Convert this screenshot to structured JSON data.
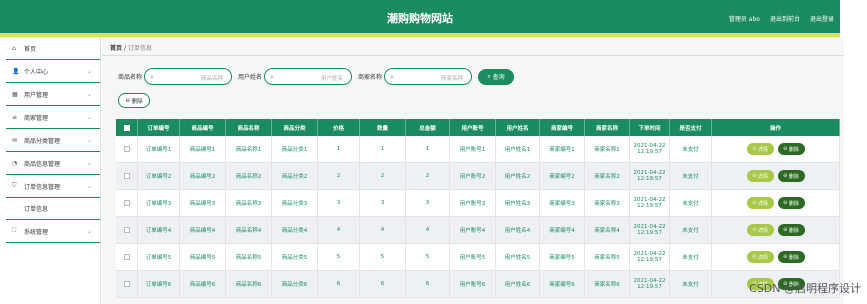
{
  "header": {
    "title": "潮购购物网站",
    "admin": "管理员 abo",
    "back": "退出到前台",
    "logout": "退出登录"
  },
  "sidebar": {
    "items": [
      {
        "icon": "home-icon",
        "glyph": "⌂",
        "label": "首页"
      },
      {
        "icon": "user-icon",
        "glyph": "👤",
        "label": "个人中心"
      },
      {
        "icon": "users-icon",
        "glyph": "▦",
        "label": "用户管理"
      },
      {
        "icon": "list-icon",
        "glyph": "≡",
        "label": "商家管理"
      },
      {
        "icon": "mail-icon",
        "glyph": "✉",
        "label": "商品分类管理"
      },
      {
        "icon": "clock-icon",
        "glyph": "◔",
        "label": "商品信息管理"
      },
      {
        "icon": "shield-icon",
        "glyph": "⛉",
        "label": "订单信息管理"
      }
    ],
    "sub": "订单信息",
    "last": {
      "icon": "expand-icon",
      "glyph": "⛶",
      "label": "系统管理"
    }
  },
  "crumb": {
    "home": "首页",
    "sep": "/",
    "current": "订单信息"
  },
  "search": {
    "f1_label": "商品名称",
    "f1_ph": "商品名称",
    "f2_label": "用户姓名",
    "f2_ph": "用户姓名",
    "f3_label": "商家名称",
    "f3_ph": "商家名称",
    "button": "查询"
  },
  "delete_top": "删除",
  "columns": [
    "",
    "订单编号",
    "商品编号",
    "商品名称",
    "商品分类",
    "价格",
    "数量",
    "总金额",
    "用户账号",
    "用户姓名",
    "商家编号",
    "商家名称",
    "下单时间",
    "是否支付",
    "操作"
  ],
  "rows": [
    [
      "订单编号1",
      "商品编号1",
      "商品名称1",
      "商品分类1",
      "1",
      "1",
      "1",
      "用户账号1",
      "用户姓名1",
      "商家编号1",
      "商家名称1",
      "2021-04-22 12:19:57",
      "未支付"
    ],
    [
      "订单编号2",
      "商品编号2",
      "商品名称2",
      "商品分类2",
      "2",
      "2",
      "2",
      "用户账号2",
      "用户姓名2",
      "商家编号2",
      "商家名称2",
      "2021-04-22 12:19:57",
      "未支付"
    ],
    [
      "订单编号3",
      "商品编号3",
      "商品名称3",
      "商品分类3",
      "3",
      "3",
      "3",
      "用户账号3",
      "用户姓名3",
      "商家编号3",
      "商家名称3",
      "2021-04-22 12:19:57",
      "未支付"
    ],
    [
      "订单编号4",
      "商品编号4",
      "商品名称4",
      "商品分类4",
      "4",
      "4",
      "4",
      "用户账号4",
      "用户姓名4",
      "商家编号4",
      "商家名称4",
      "2021-04-22 12:19:57",
      "未支付"
    ],
    [
      "订单编号5",
      "商品编号5",
      "商品名称5",
      "商品分类5",
      "5",
      "5",
      "5",
      "用户账号5",
      "用户姓名5",
      "商家编号5",
      "商家名称5",
      "2021-04-22 12:19:57",
      "未支付"
    ],
    [
      "订单编号6",
      "商品编号6",
      "商品名称6",
      "商品分类6",
      "6",
      "6",
      "6",
      "用户账号6",
      "用户姓名6",
      "商家编号6",
      "商家名称6",
      "2021-04-22 12:19:57",
      "未支付"
    ]
  ],
  "edit_label": "详情",
  "delete_label": "删除",
  "watermark": "CSDN @启明程序设计"
}
